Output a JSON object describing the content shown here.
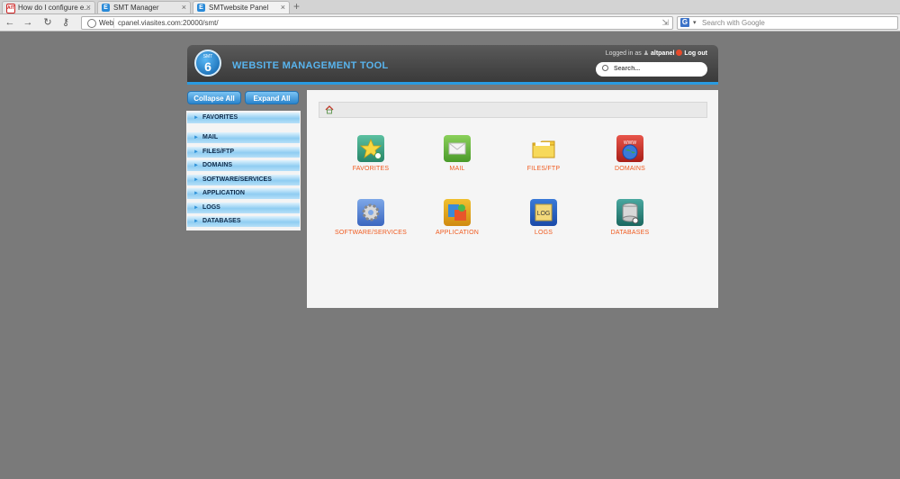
{
  "browser": {
    "tabs": [
      {
        "title": "How do I configure e...",
        "favicon": "AIT",
        "active": false
      },
      {
        "title": "SMT Manager",
        "favicon": "E",
        "active": false
      },
      {
        "title": "SMTwebsite Panel",
        "favicon": "E",
        "active": true
      }
    ],
    "new_tab_label": "+",
    "url_prefix": "Web",
    "url": "cpanel.viasites.com:20000/smt/",
    "search_placeholder": "Search with Google",
    "search_engine": "G"
  },
  "header": {
    "logo_top": "SMT",
    "logo_number": "6",
    "title": "WEBSITE MANAGEMENT TOOL",
    "logged_in_label": "Logged in as",
    "username": "altpanel",
    "logout_label": "Log out",
    "search_placeholder": "Search..."
  },
  "buttons": {
    "collapse_all": "Collapse All",
    "expand_all": "Expand All"
  },
  "sidebar": {
    "items": [
      {
        "label": "FAVORITES"
      },
      {
        "label": "MAIL"
      },
      {
        "label": "FILES/FTP"
      },
      {
        "label": "DOMAINS"
      },
      {
        "label": "SOFTWARE/SERVICES"
      },
      {
        "label": "APPLICATION"
      },
      {
        "label": "LOGS"
      },
      {
        "label": "DATABASES"
      }
    ]
  },
  "tiles": [
    {
      "label": "FAVORITES",
      "icon": "star-icon"
    },
    {
      "label": "MAIL",
      "icon": "envelope-icon"
    },
    {
      "label": "FILES/FTP",
      "icon": "folder-icon"
    },
    {
      "label": "DOMAINS",
      "icon": "globe-www-icon"
    },
    {
      "label": "SOFTWARE/SERVICES",
      "icon": "gear-icon"
    },
    {
      "label": "APPLICATION",
      "icon": "application-icon"
    },
    {
      "label": "LOGS",
      "icon": "log-book-icon"
    },
    {
      "label": "DATABASES",
      "icon": "database-icon"
    }
  ],
  "colors": {
    "accent": "#2a9be0",
    "tile_label": "#f05a1e",
    "background": "#7a7a7a"
  }
}
